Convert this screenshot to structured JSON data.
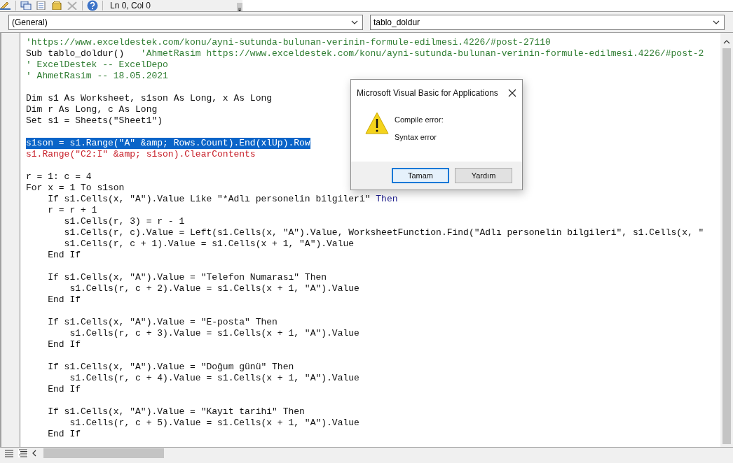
{
  "toolbar": {
    "position": "Ln 0, Col 0"
  },
  "combos": [
    {
      "value": "(General)"
    },
    {
      "value": "tablo_doldur"
    }
  ],
  "code": {
    "blocks": [
      {
        "lines": [
          {
            "selected": false,
            "segments": [
              {
                "kind": "comment",
                "text": "'https://www.exceldestek.com/konu/ayni-sutunda-bulunan-verinin-formule-edilmesi.4226/#post-27110"
              }
            ]
          },
          {
            "selected": false,
            "segments": [
              {
                "kind": "code",
                "text": "Sub tablo_doldur()   "
              },
              {
                "kind": "comment",
                "text": "'AhmetRasim https://www.exceldestek.com/konu/ayni-sutunda-bulunan-verinin-formule-edilmesi.4226/#post-2"
              }
            ]
          },
          {
            "selected": false,
            "segments": [
              {
                "kind": "comment",
                "text": "' ExcelDestek -- ExcelDepo"
              }
            ]
          },
          {
            "selected": false,
            "segments": [
              {
                "kind": "comment",
                "text": "' AhmetRasim -- 18.05.2021"
              }
            ]
          }
        ]
      },
      {
        "lines": [
          {
            "selected": false,
            "segments": [
              {
                "kind": "code",
                "text": "Dim s1 As Worksheet, s1son As Long, x As Long"
              }
            ]
          },
          {
            "selected": false,
            "segments": [
              {
                "kind": "code",
                "text": "Dim r As Long, c As Long"
              }
            ]
          },
          {
            "selected": false,
            "segments": [
              {
                "kind": "code",
                "text": "Set s1 = Sheets(\"Sheet1\")"
              }
            ]
          }
        ]
      },
      {
        "lines": [
          {
            "selected": true,
            "segments": [
              {
                "kind": "code",
                "text": "s1son = s1.Range(\"A\" &amp; Rows.Count).End(xlUp).Row"
              }
            ]
          },
          {
            "selected": false,
            "segments": [
              {
                "kind": "error",
                "text": "s1.Range(\"C2:I\" &amp; s1son).ClearContents"
              }
            ]
          }
        ]
      },
      {
        "lines": [
          {
            "selected": false,
            "segments": [
              {
                "kind": "code",
                "text": "r = 1: c = 4"
              }
            ]
          },
          {
            "selected": false,
            "segments": [
              {
                "kind": "code",
                "text": "For x = 1 To s1son"
              }
            ]
          },
          {
            "selected": false,
            "segments": [
              {
                "kind": "code",
                "text": "    If s1.Cells(x, \"A\").Value Like \"*Adlı personelin bilgileri\" "
              },
              {
                "kind": "keyword",
                "text": "Then"
              }
            ]
          },
          {
            "selected": false,
            "segments": [
              {
                "kind": "code",
                "text": "    r = r + 1"
              }
            ]
          },
          {
            "selected": false,
            "segments": [
              {
                "kind": "code",
                "text": "       s1.Cells(r, 3) = r - 1"
              }
            ]
          },
          {
            "selected": false,
            "segments": [
              {
                "kind": "code",
                "text": "       s1.Cells(r, c).Value = Left(s1.Cells(x, \"A\").Value, WorksheetFunction.Find(\"Adlı personelin bilgileri\", s1.Cells(x, \""
              }
            ]
          },
          {
            "selected": false,
            "segments": [
              {
                "kind": "code",
                "text": "       s1.Cells(r, c + 1).Value = s1.Cells(x + 1, \"A\").Value"
              }
            ]
          },
          {
            "selected": false,
            "segments": [
              {
                "kind": "code",
                "text": "    End If"
              }
            ]
          }
        ]
      },
      {
        "lines": [
          {
            "selected": false,
            "segments": [
              {
                "kind": "code",
                "text": "    If s1.Cells(x, \"A\").Value = \"Telefon Numarası\" Then"
              }
            ]
          },
          {
            "selected": false,
            "segments": [
              {
                "kind": "code",
                "text": "        s1.Cells(r, c + 2).Value = s1.Cells(x + 1, \"A\").Value"
              }
            ]
          },
          {
            "selected": false,
            "segments": [
              {
                "kind": "code",
                "text": "    End If"
              }
            ]
          }
        ]
      },
      {
        "lines": [
          {
            "selected": false,
            "segments": [
              {
                "kind": "code",
                "text": "    If s1.Cells(x, \"A\").Value = \"E-posta\" Then"
              }
            ]
          },
          {
            "selected": false,
            "segments": [
              {
                "kind": "code",
                "text": "        s1.Cells(r, c + 3).Value = s1.Cells(x + 1, \"A\").Value"
              }
            ]
          },
          {
            "selected": false,
            "segments": [
              {
                "kind": "code",
                "text": "    End If"
              }
            ]
          }
        ]
      },
      {
        "lines": [
          {
            "selected": false,
            "segments": [
              {
                "kind": "code",
                "text": "    If s1.Cells(x, \"A\").Value = \"Doğum günü\" Then"
              }
            ]
          },
          {
            "selected": false,
            "segments": [
              {
                "kind": "code",
                "text": "        s1.Cells(r, c + 4).Value = s1.Cells(x + 1, \"A\").Value"
              }
            ]
          },
          {
            "selected": false,
            "segments": [
              {
                "kind": "code",
                "text": "    End If"
              }
            ]
          }
        ]
      },
      {
        "lines": [
          {
            "selected": false,
            "segments": [
              {
                "kind": "code",
                "text": "    If s1.Cells(x, \"A\").Value = \"Kayıt tarihi\" Then"
              }
            ]
          },
          {
            "selected": false,
            "segments": [
              {
                "kind": "code",
                "text": "        s1.Cells(r, c + 5).Value = s1.Cells(x + 1, \"A\").Value"
              }
            ]
          },
          {
            "selected": false,
            "segments": [
              {
                "kind": "code",
                "text": "    End If"
              }
            ]
          }
        ]
      }
    ]
  },
  "dialog": {
    "title": "Microsoft Visual Basic for Applications",
    "heading": "Compile error:",
    "message": "Syntax error",
    "buttons": [
      {
        "label": "Tamam",
        "focused": true
      },
      {
        "label": "Yardım",
        "focused": false
      }
    ]
  }
}
